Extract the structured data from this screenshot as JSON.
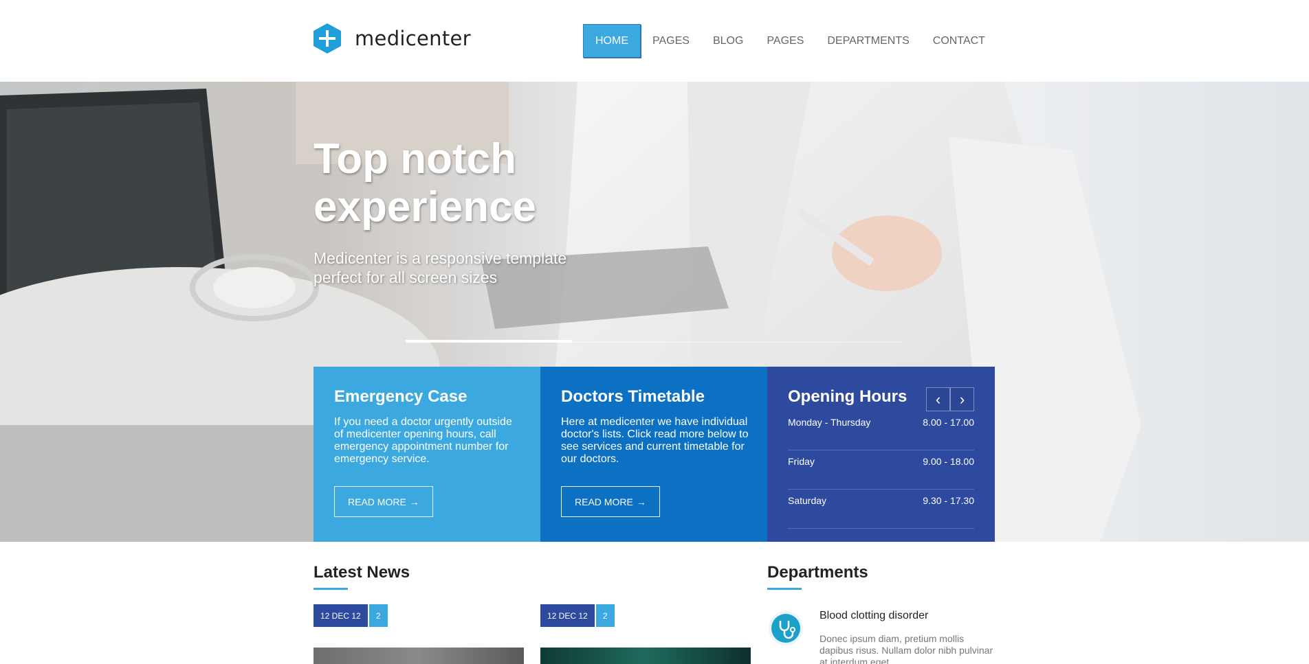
{
  "brand": {
    "name": "medicenter",
    "accent": "#3ba9e0"
  },
  "nav": {
    "items": [
      {
        "label": "HOME",
        "active": true
      },
      {
        "label": "PAGES"
      },
      {
        "label": "BLOG"
      },
      {
        "label": "PAGES"
      },
      {
        "label": "DEPARTMENTS"
      },
      {
        "label": "CONTACT"
      }
    ]
  },
  "hero": {
    "title": "Top notch experience",
    "subtitle": "Medicenter is a responsive template perfect for all screen sizes"
  },
  "boxes": {
    "emergency": {
      "title": "Emergency Case",
      "text": "If you need a doctor urgently outside of medicenter opening hours, call emergency appointment number for emergency service.",
      "button": "READ MORE",
      "color": "#3ba9e0"
    },
    "timetable": {
      "title": "Doctors Timetable",
      "text": "Here at medicenter we have individual doctor's lists. Click read more below to see services and current timetable for our doctors.",
      "button": "READ MORE",
      "color": "#0c71c3"
    },
    "hours": {
      "title": "Opening Hours",
      "prev": "‹",
      "next": "›",
      "color": "#2e4a9e",
      "rows": [
        {
          "day": "Monday - Thursday",
          "time": "8.00 - 17.00"
        },
        {
          "day": "Friday",
          "time": "9.00 - 18.00"
        },
        {
          "day": "Saturday",
          "time": "9.30 - 17.30"
        }
      ]
    }
  },
  "news": {
    "title": "Latest News",
    "items": [
      {
        "date": "12 DEC 12",
        "comments": "2"
      },
      {
        "date": "12 DEC 12",
        "comments": "2"
      }
    ]
  },
  "departments": {
    "title": "Departments",
    "items": [
      {
        "title": "Blood clotting disorder",
        "text": "Donec ipsum diam, pretium mollis dapibus risus. Nullam dolor nibh pulvinar at interdum eget",
        "icon": "stethoscope-icon"
      }
    ]
  }
}
